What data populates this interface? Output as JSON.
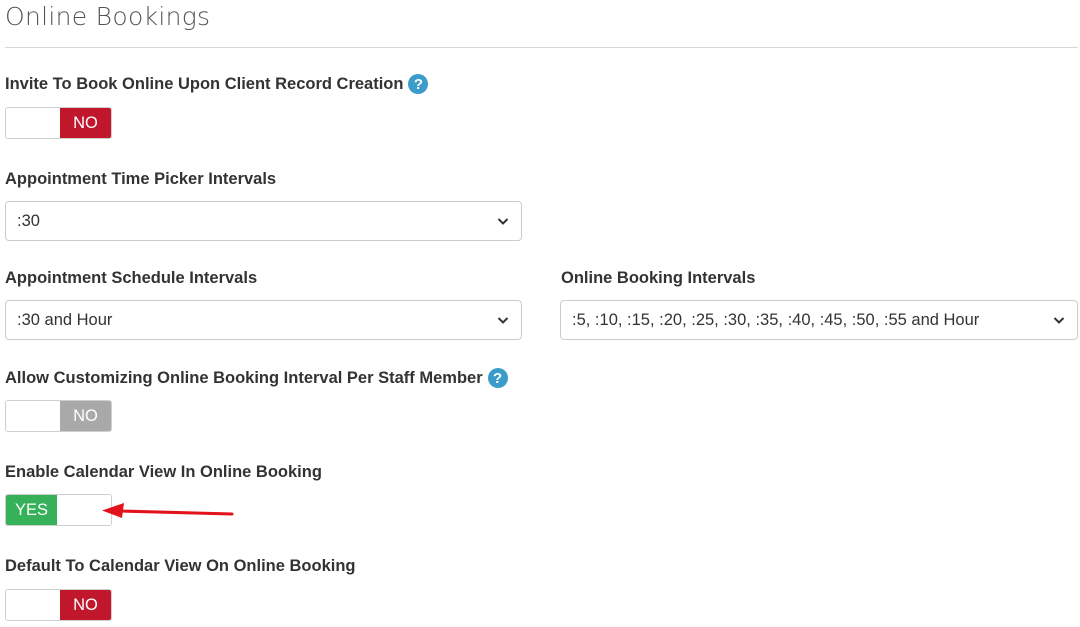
{
  "page": {
    "title": "Online Bookings"
  },
  "settings": {
    "invite_to_book": {
      "label": "Invite To Book Online Upon Client Record Creation",
      "value": "NO"
    },
    "time_picker_intervals": {
      "label": "Appointment Time Picker Intervals",
      "value": ":30"
    },
    "schedule_intervals": {
      "label": "Appointment Schedule Intervals",
      "value": ":30 and Hour"
    },
    "online_booking_intervals": {
      "label": "Online Booking Intervals",
      "value": ":5, :10, :15, :20, :25, :30, :35, :40, :45, :50, :55 and Hour"
    },
    "customize_interval_per_staff": {
      "label": "Allow Customizing Online Booking Interval Per Staff Member",
      "value": "NO"
    },
    "calendar_view": {
      "label": "Enable Calendar View In Online Booking",
      "value": "YES"
    },
    "default_calendar_view": {
      "label": "Default To Calendar View On Online Booking",
      "value": "NO"
    }
  },
  "help_icon_glyph": "?",
  "colors": {
    "yes": "#36b15a",
    "no_active": "#c0172c",
    "no_disabled": "#a9a9a9",
    "help": "#3b9ccc",
    "annotation_arrow": "#e3131b"
  }
}
